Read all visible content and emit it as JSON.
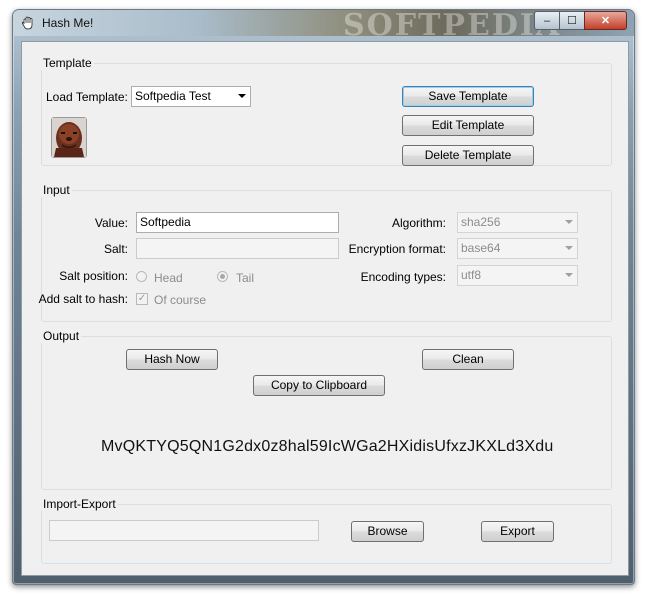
{
  "window": {
    "title": "Hash Me!",
    "close_glyph": "✕",
    "minimize_glyph": "–",
    "maximize_glyph": "☐",
    "watermark": "SOFTPEDIA"
  },
  "template": {
    "group_label": "Template",
    "load_label": "Load Template:",
    "selected_template": "Softpedia Test",
    "save_button": "Save Template",
    "edit_button": "Edit Template",
    "delete_button": "Delete Template",
    "icon": "chewbacca-avatar-icon"
  },
  "input": {
    "group_label": "Input",
    "value_label": "Value:",
    "value": "Softpedia",
    "salt_label": "Salt:",
    "salt_value": "",
    "salt_position_label": "Salt position:",
    "head_label": "Head",
    "tail_label": "Tail",
    "selected_position": "Tail",
    "add_salt_label": "Add salt to hash:",
    "of_course_label": "Of course",
    "of_course_checked": true,
    "algorithm_label": "Algorithm:",
    "algorithm": "sha256",
    "encryption_label": "Encryption format:",
    "encryption": "base64",
    "encoding_label": "Encoding types:",
    "encoding": "utf8"
  },
  "output": {
    "group_label": "Output",
    "hash_now_button": "Hash Now",
    "clean_button": "Clean",
    "copy_button": "Copy to Clipboard",
    "result": "MvQKTYQ5QN1G2dx0z8hal59IcWGa2HXidisUfxzJKXLd3Xdu"
  },
  "import_export": {
    "group_label": "Import-Export",
    "path_value": "",
    "browse_button": "Browse",
    "export_button": "Export"
  }
}
